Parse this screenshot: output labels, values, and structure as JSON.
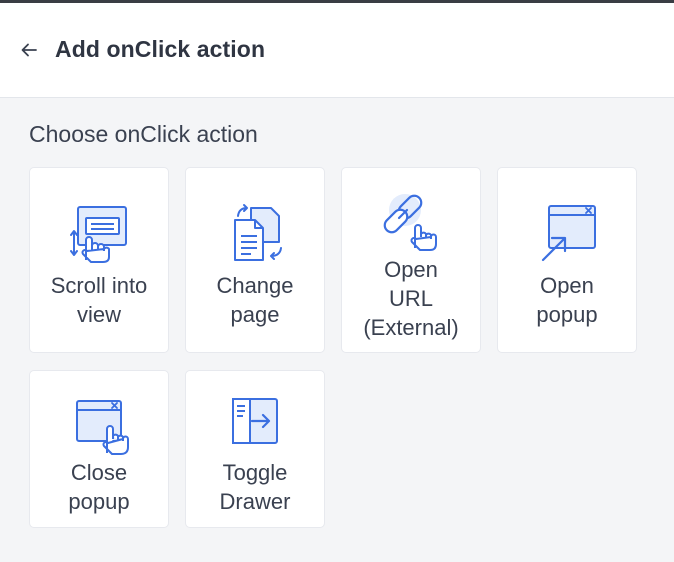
{
  "header": {
    "title": "Add onClick action",
    "back_icon": "arrow-left-icon"
  },
  "section": {
    "title": "Choose onClick action"
  },
  "actions": [
    {
      "label": "Scroll into\nview",
      "icon": "scroll-into-view-icon"
    },
    {
      "label": "Change\npage",
      "icon": "change-page-icon"
    },
    {
      "label": "Open\nURL\n(External)",
      "icon": "link-click-icon"
    },
    {
      "label": "Open\npopup",
      "icon": "open-popup-icon"
    },
    {
      "label": "Close\npopup",
      "icon": "close-popup-icon"
    },
    {
      "label": "Toggle\nDrawer",
      "icon": "toggle-drawer-icon"
    }
  ],
  "colors": {
    "icon_stroke": "#3b6fe0",
    "icon_fill": "#e3ecfc",
    "text": "#3a4150",
    "background": "#f4f5f7"
  }
}
